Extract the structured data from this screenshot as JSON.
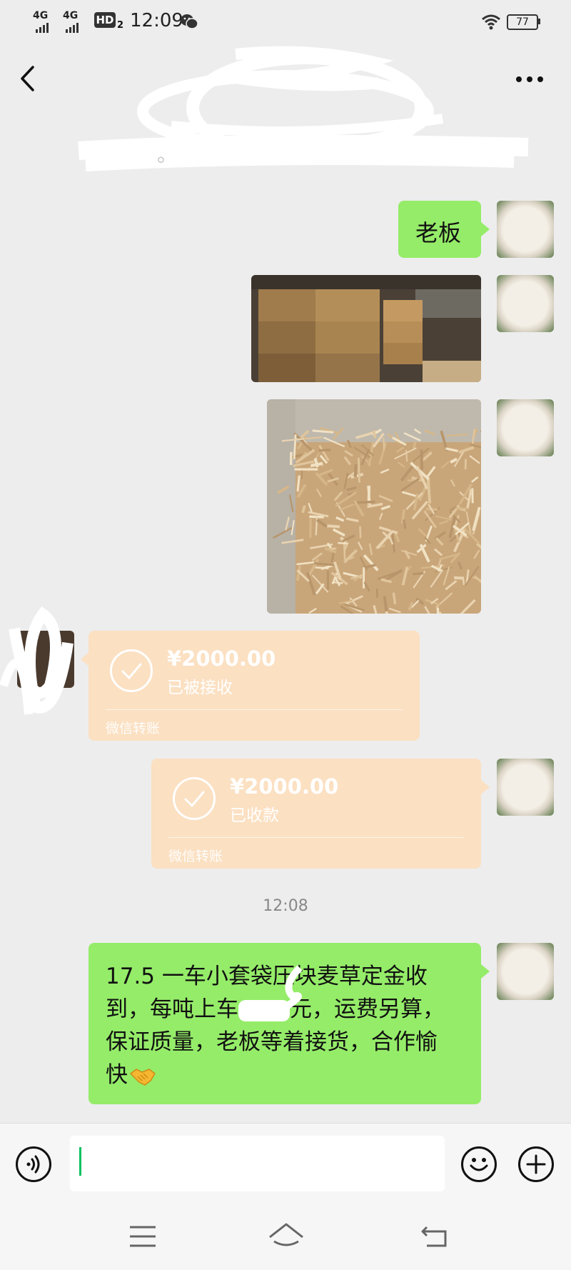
{
  "status_bar": {
    "network_1": "4G",
    "network_2": "4G",
    "hd_badge": "HD",
    "hd_sub": "2",
    "time": "12:09",
    "battery": "77"
  },
  "conversation": {
    "redacted_title": "",
    "messages": [
      {
        "type": "text",
        "from": "me",
        "text": "老板"
      },
      {
        "type": "image",
        "from": "me",
        "alt": "stacked hay bales"
      },
      {
        "type": "image",
        "from": "me",
        "alt": "chopped wheat straw"
      },
      {
        "type": "transfer",
        "from": "other",
        "amount": "¥2000.00",
        "status": "已被接收",
        "label": "微信转账"
      },
      {
        "type": "transfer",
        "from": "me",
        "amount": "¥2000.00",
        "status": "已收款",
        "label": "微信转账"
      },
      {
        "type": "timestamp",
        "text": "12:08"
      },
      {
        "type": "text",
        "from": "me",
        "lines": [
          "17.5 一车小套袋压块麦草定金收",
          "到，每吨上车",
          "元，运费另算，",
          "保证质量，老板等着接货，合作愉",
          "快"
        ],
        "emoji": "handshake"
      }
    ]
  },
  "input_bar": {
    "voice_icon": "voice-icon",
    "emoji_icon": "smile-icon",
    "plus_icon": "plus-icon",
    "value": ""
  },
  "colors": {
    "bubble_green": "#95ec69",
    "transfer_orange": "#fbe0c2",
    "background": "#ededed",
    "caret": "#07c160"
  }
}
